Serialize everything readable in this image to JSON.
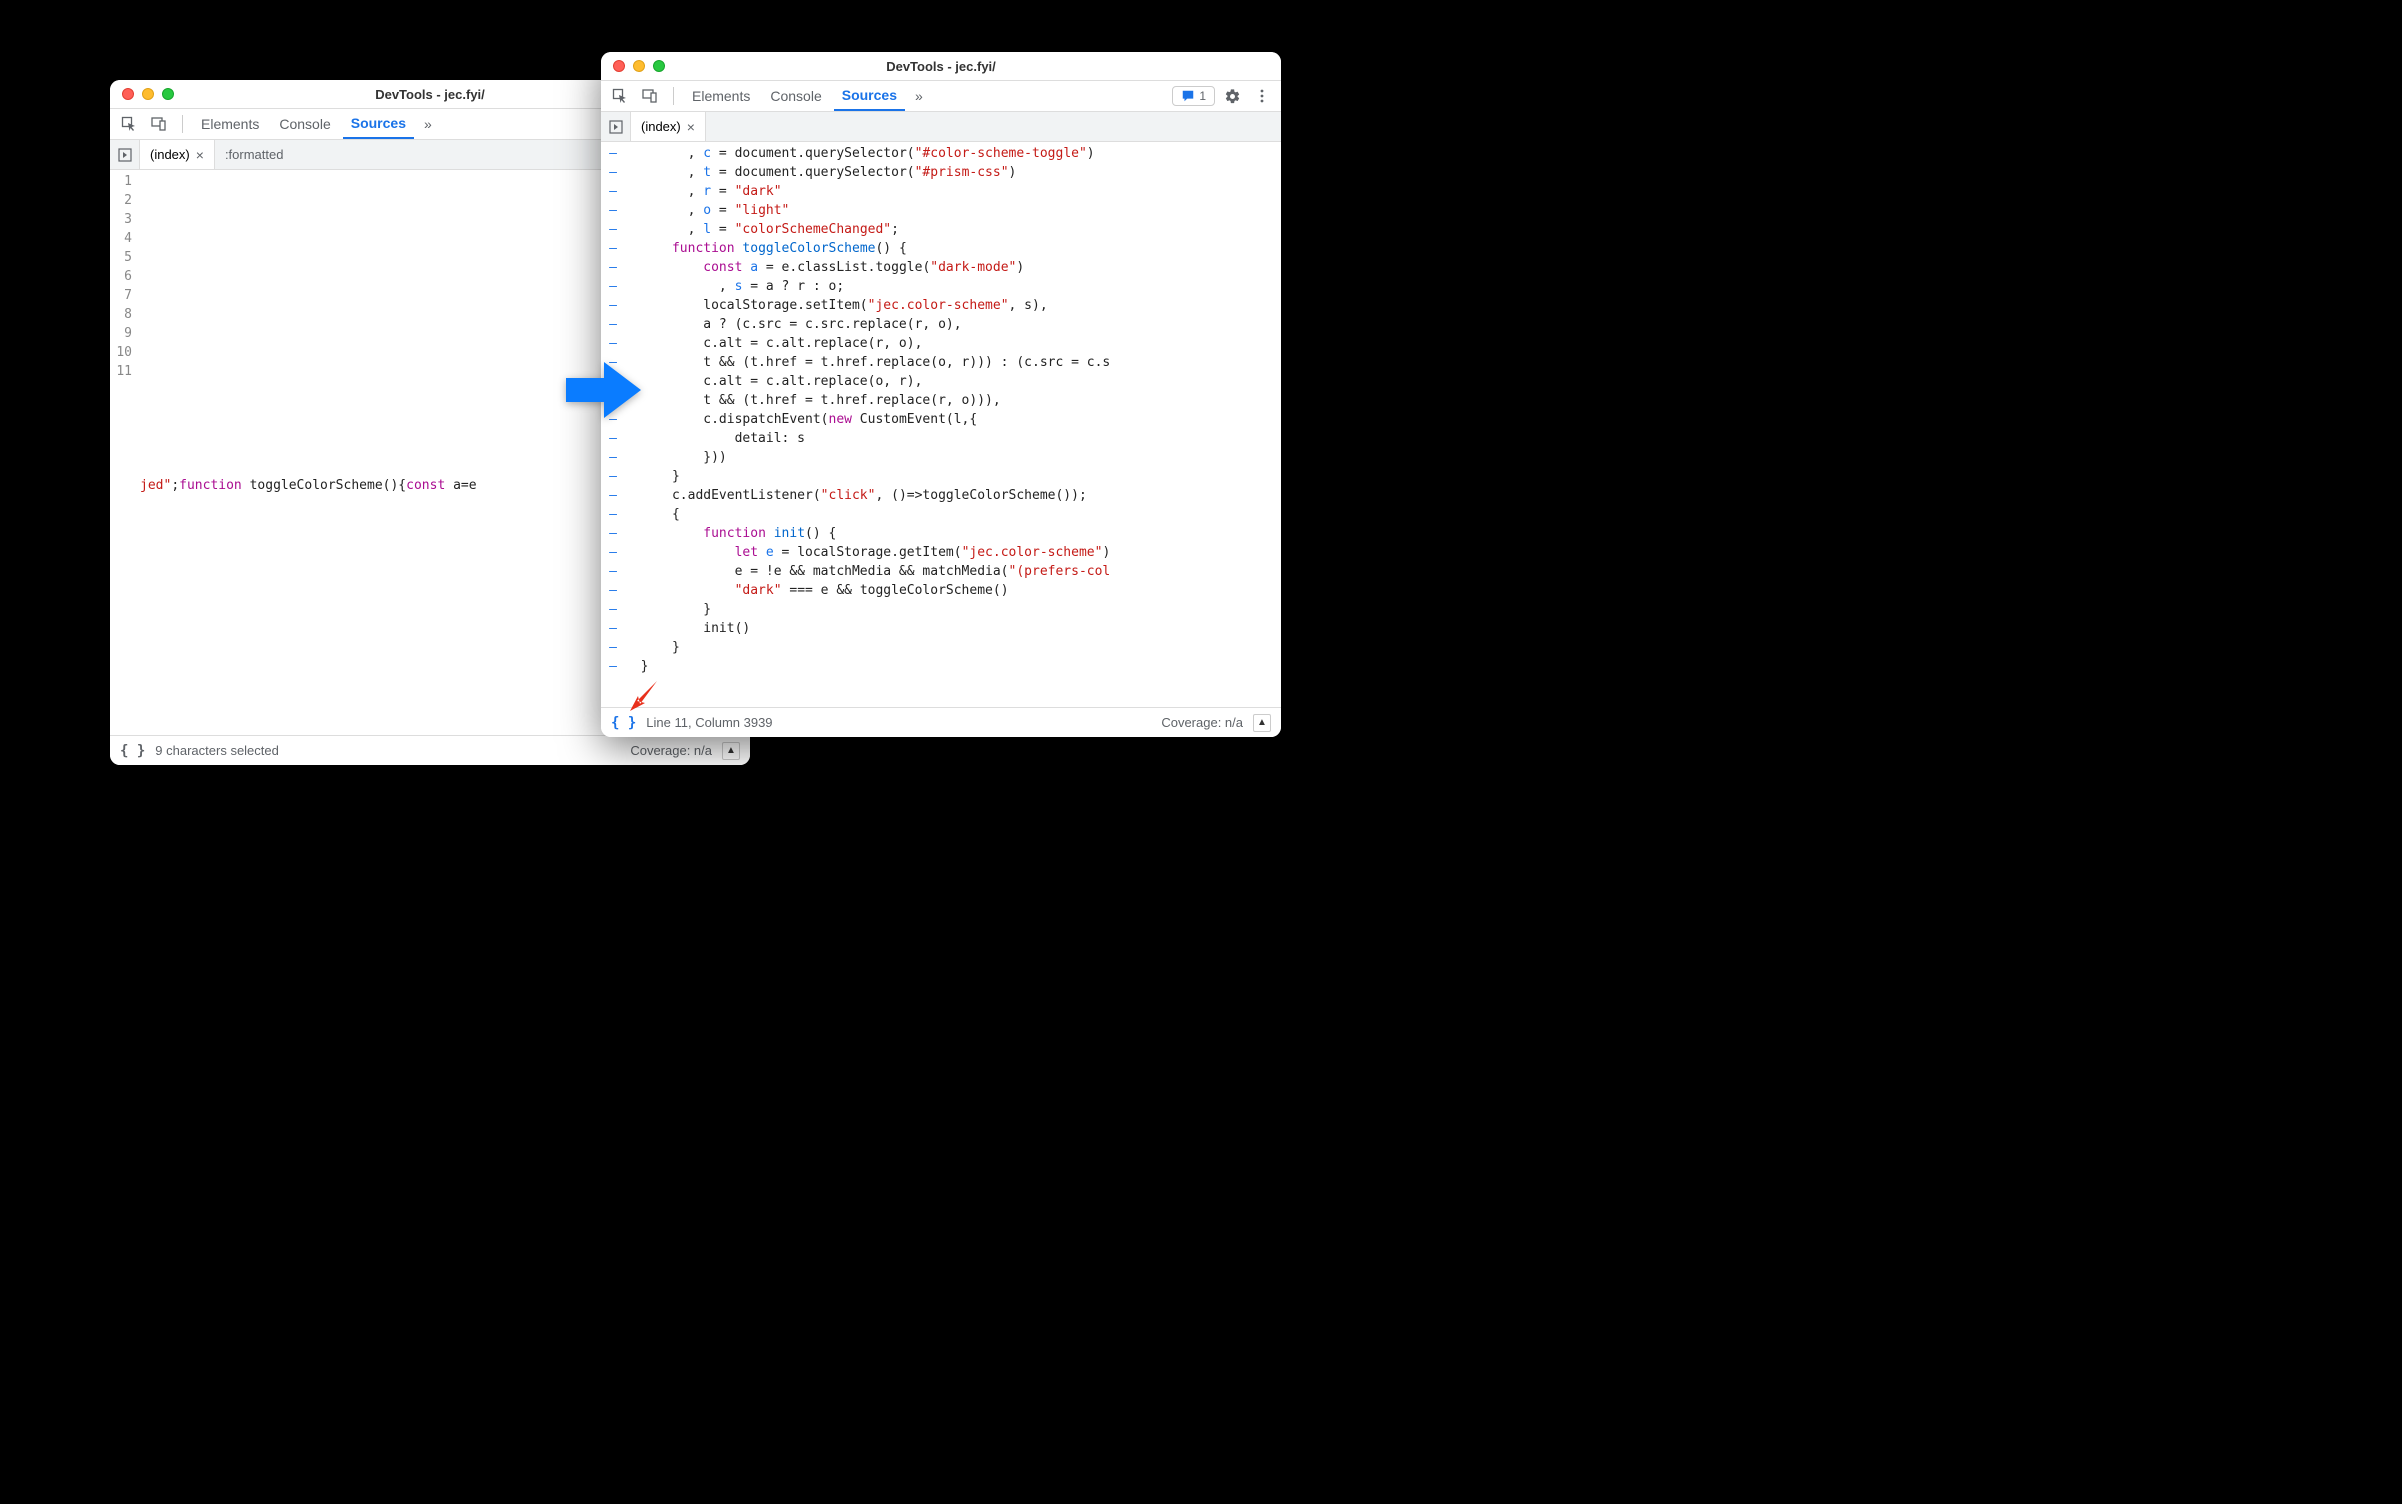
{
  "winLeft": {
    "title": "DevTools - jec.fyi/",
    "tabs": {
      "elements": "Elements",
      "console": "Console",
      "sources": "Sources"
    },
    "fileTabs": {
      "index": "(index)",
      "formatted": ":formatted"
    },
    "lines": [
      "1",
      "2",
      "3",
      "4",
      "5",
      "6",
      "7",
      "8",
      "9",
      "10",
      "11"
    ],
    "codePrefix": "jed\"",
    "codeSep1": ";",
    "codeKw1": "function",
    "codeFn": " toggleColorScheme",
    "codeParen": "(){",
    "codeKw2": "const",
    "codeTail": " a=e",
    "status": {
      "selection": "9 characters selected",
      "coverage": "Coverage: n/a"
    }
  },
  "winRight": {
    "title": "DevTools - jec.fyi/",
    "tabs": {
      "elements": "Elements",
      "console": "Console",
      "sources": "Sources"
    },
    "issueCount": "1",
    "fileTabs": {
      "index": "(index)"
    },
    "code": [
      {
        "indent": "        , ",
        "segs": [
          [
            "var",
            "c"
          ],
          [
            "p",
            " = document.querySelector("
          ],
          [
            "str",
            "\"#color-scheme-toggle\""
          ],
          [
            "p",
            ")"
          ]
        ]
      },
      {
        "indent": "        , ",
        "segs": [
          [
            "var",
            "t"
          ],
          [
            "p",
            " = document.querySelector("
          ],
          [
            "str",
            "\"#prism-css\""
          ],
          [
            "p",
            ")"
          ]
        ]
      },
      {
        "indent": "        , ",
        "segs": [
          [
            "var",
            "r"
          ],
          [
            "p",
            " = "
          ],
          [
            "str",
            "\"dark\""
          ]
        ]
      },
      {
        "indent": "        , ",
        "segs": [
          [
            "var",
            "o"
          ],
          [
            "p",
            " = "
          ],
          [
            "str",
            "\"light\""
          ]
        ]
      },
      {
        "indent": "        , ",
        "segs": [
          [
            "var",
            "l"
          ],
          [
            "p",
            " = "
          ],
          [
            "str",
            "\"colorSchemeChanged\""
          ],
          [
            "p",
            ";"
          ]
        ]
      },
      {
        "indent": "      ",
        "segs": [
          [
            "kw",
            "function"
          ],
          [
            "p",
            " "
          ],
          [
            "def",
            "toggleColorScheme"
          ],
          [
            "p",
            "() {"
          ]
        ]
      },
      {
        "indent": "          ",
        "segs": [
          [
            "kw",
            "const"
          ],
          [
            "p",
            " "
          ],
          [
            "var",
            "a"
          ],
          [
            "p",
            " = e.classList.toggle("
          ],
          [
            "str",
            "\"dark-mode\""
          ],
          [
            "p",
            ")"
          ]
        ]
      },
      {
        "indent": "            , ",
        "segs": [
          [
            "var",
            "s"
          ],
          [
            "p",
            " = a ? r : o;"
          ]
        ]
      },
      {
        "indent": "          ",
        "segs": [
          [
            "p",
            "localStorage.setItem("
          ],
          [
            "str",
            "\"jec.color-scheme\""
          ],
          [
            "p",
            ", s),"
          ]
        ]
      },
      {
        "indent": "          ",
        "segs": [
          [
            "p",
            "a ? (c.src = c.src.replace(r, o),"
          ]
        ]
      },
      {
        "indent": "          ",
        "segs": [
          [
            "p",
            "c.alt = c.alt.replace(r, o),"
          ]
        ]
      },
      {
        "indent": "          ",
        "segs": [
          [
            "p",
            "t && (t.href = t.href.replace(o, r))) : (c.src = c.s"
          ]
        ]
      },
      {
        "indent": "          ",
        "segs": [
          [
            "p",
            "c.alt = c.alt.replace(o, r),"
          ]
        ]
      },
      {
        "indent": "          ",
        "segs": [
          [
            "p",
            "t && (t.href = t.href.replace(r, o))),"
          ]
        ]
      },
      {
        "indent": "          ",
        "segs": [
          [
            "p",
            "c.dispatchEvent("
          ],
          [
            "kw",
            "new"
          ],
          [
            "p",
            " CustomEvent(l,{"
          ]
        ]
      },
      {
        "indent": "              ",
        "segs": [
          [
            "p",
            "detail: s"
          ]
        ]
      },
      {
        "indent": "          ",
        "segs": [
          [
            "p",
            "}))"
          ]
        ]
      },
      {
        "indent": "      ",
        "segs": [
          [
            "p",
            "}"
          ]
        ]
      },
      {
        "indent": "      ",
        "segs": [
          [
            "p",
            "c.addEventListener("
          ],
          [
            "str",
            "\"click\""
          ],
          [
            "p",
            ", ()=>toggleColorScheme());"
          ]
        ]
      },
      {
        "indent": "      ",
        "segs": [
          [
            "p",
            "{"
          ]
        ]
      },
      {
        "indent": "          ",
        "segs": [
          [
            "kw",
            "function"
          ],
          [
            "p",
            " "
          ],
          [
            "def",
            "init"
          ],
          [
            "p",
            "() {"
          ]
        ]
      },
      {
        "indent": "              ",
        "segs": [
          [
            "kw",
            "let"
          ],
          [
            "p",
            " "
          ],
          [
            "var",
            "e"
          ],
          [
            "p",
            " = localStorage.getItem("
          ],
          [
            "str",
            "\"jec.color-scheme\""
          ],
          [
            "p",
            ")"
          ]
        ]
      },
      {
        "indent": "              ",
        "segs": [
          [
            "p",
            "e = !e && matchMedia && matchMedia("
          ],
          [
            "str",
            "\"(prefers-col"
          ]
        ]
      },
      {
        "indent": "              ",
        "segs": [
          [
            "str",
            "\"dark\""
          ],
          [
            "p",
            " === e && toggleColorScheme()"
          ]
        ]
      },
      {
        "indent": "          ",
        "segs": [
          [
            "p",
            "}"
          ]
        ]
      },
      {
        "indent": "          ",
        "segs": [
          [
            "p",
            "init()"
          ]
        ]
      },
      {
        "indent": "      ",
        "segs": [
          [
            "p",
            "}"
          ]
        ]
      },
      {
        "indent": "  ",
        "segs": [
          [
            "p",
            "}"
          ]
        ]
      }
    ],
    "status": {
      "position": "Line 11, Column 3939",
      "coverage": "Coverage: n/a"
    }
  }
}
